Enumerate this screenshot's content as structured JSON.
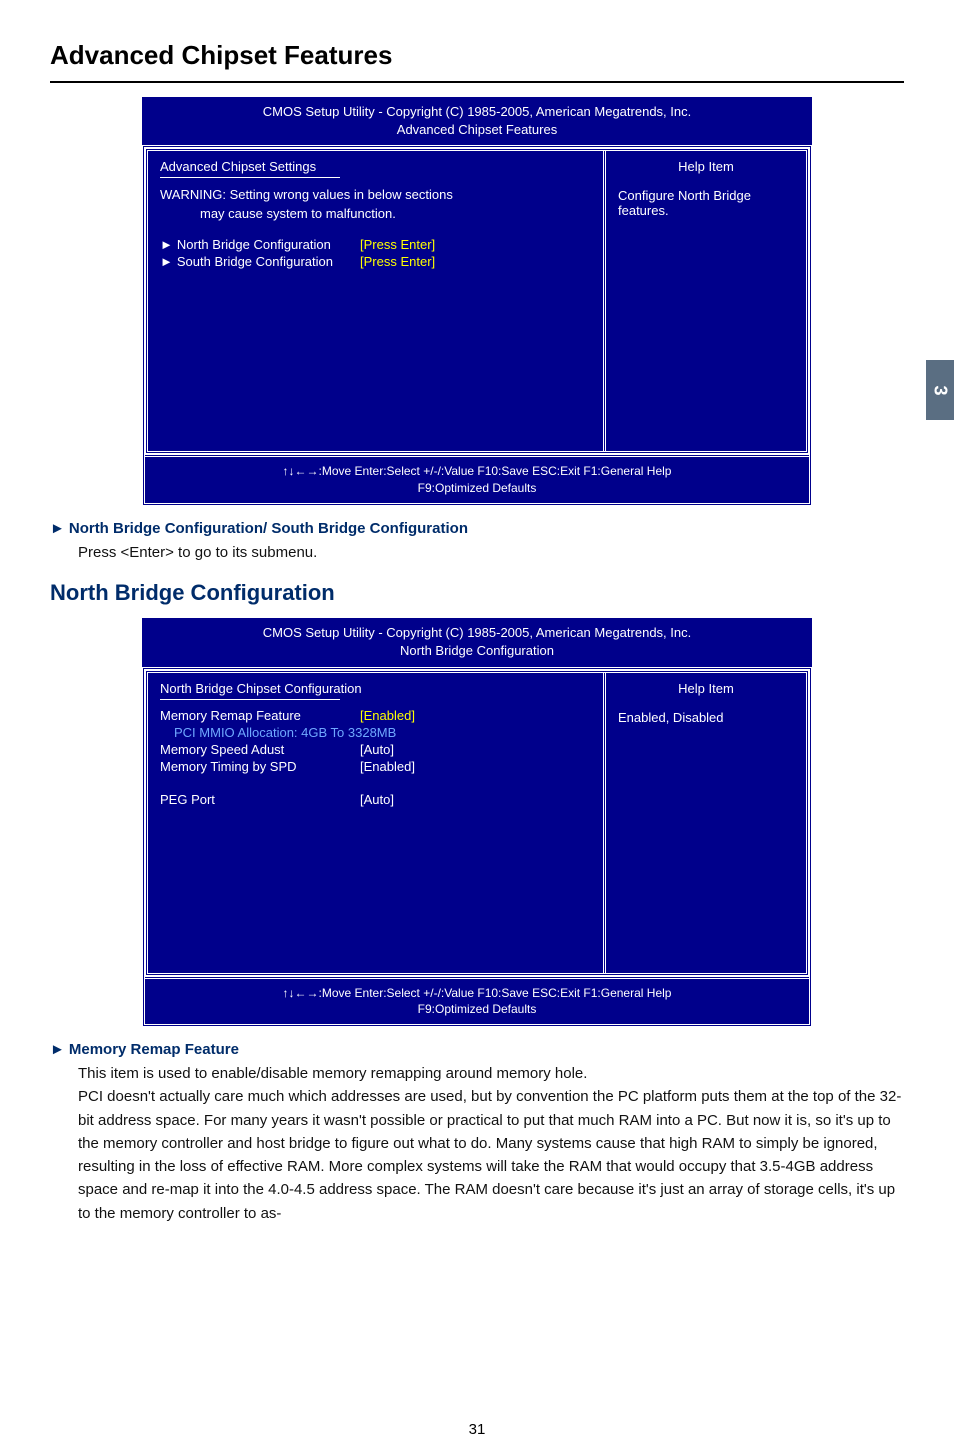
{
  "pageTab": "3",
  "sectionTitle": "Advanced Chipset Features",
  "bios1": {
    "headerLine1": "CMOS Setup Utility - Copyright (C) 1985-2005, American Megatrends, Inc.",
    "headerLine2": "Advanced Chipset Features",
    "leftHeader": "Advanced Chipset Settings",
    "warning": "WARNING: Setting wrong values in below sections",
    "warning2": "may cause system to malfunction.",
    "rows": [
      {
        "label": "North Bridge Configuration",
        "value": "[Press Enter]",
        "tri": true
      },
      {
        "label": "South Bridge Configuration",
        "value": "[Press Enter]",
        "tri": true
      }
    ],
    "helpTitle": "Help Item",
    "helpText": "Configure North Bridge features.",
    "footer1": "↑↓←→:Move   Enter:Select    +/-/:Value   F10:Save   ESC:Exit    F1:General Help",
    "footer2": "F9:Optimized Defaults"
  },
  "sub1": {
    "title": "North Bridge Configuration/ South Bridge Configuration",
    "body": "Press <Enter> to go to its submenu."
  },
  "blueTitle2": "North Bridge Configuration",
  "bios2": {
    "headerLine1": "CMOS Setup Utility - Copyright (C) 1985-2005, American Megatrends, Inc.",
    "headerLine2": "North Bridge Configuration",
    "leftHeader": "North Bridge Chipset Configuration",
    "rows": [
      {
        "label": "Memory Remap Feature",
        "value": "[Enabled]",
        "yellow": true
      },
      {
        "label": "PCI MMIO Allocation: 4GB To 3328MB",
        "value": "",
        "info": true
      },
      {
        "label": "Memory Speed Adust",
        "value": "[Auto]"
      },
      {
        "label": "Memory Timing by SPD",
        "value": "[Enabled]"
      },
      {
        "label": "",
        "value": ""
      },
      {
        "label": "PEG Port",
        "value": "[Auto]"
      }
    ],
    "helpTitle": "Help Item",
    "helpText": "Enabled, Disabled",
    "footer1": "↑↓←→:Move   Enter:Select    +/-/:Value   F10:Save   ESC:Exit    F1:General Help",
    "footer2": "F9:Optimized Defaults"
  },
  "sub2": {
    "title": "Memory Remap Feature",
    "body": "This item is used to enable/disable memory remapping around memory hole.\nPCI doesn't actually care much which addresses are used, but by convention the PC platform puts them at the top of the 32-bit address space. For many years it wasn't possible or practical to put that much RAM into a PC. But now it is, so it's up to the memory controller and host bridge to figure out what to do.  Many systems cause that high RAM to simply be ignored, resulting in the loss of effective RAM.  More complex systems will take the RAM that would occupy that 3.5-4GB address space and re-map it into the 4.0-4.5 address space. The RAM doesn't care because it's just an array of storage cells, it's up to the memory controller to as-"
  },
  "pageNumber": "31"
}
